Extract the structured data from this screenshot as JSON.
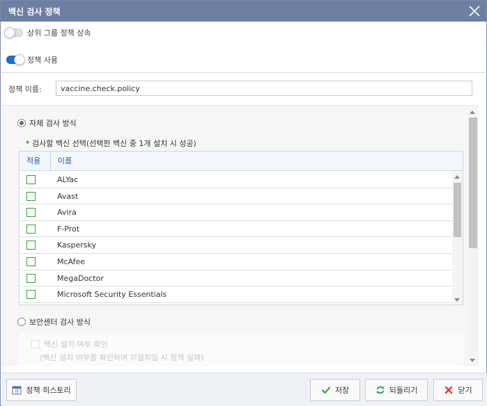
{
  "dialog": {
    "title": "백신 검사 정책",
    "close_icon": "close-icon"
  },
  "toggles": {
    "inherit_label": "상위 그룹 정책 상속",
    "inherit_on": false,
    "use_label": "정책 사용",
    "use_on": true
  },
  "policy_name": {
    "label": "정책 이름:",
    "value": "vaccine.check.policy"
  },
  "self_check": {
    "label": "자체 검사 방식",
    "selected": true,
    "hint": "* 검사할 백신 선택(선택한 백신 중 1개 설치 시 성공)"
  },
  "grid": {
    "col_apply": "적용",
    "col_name": "이름",
    "rows": [
      {
        "name": "ALYac",
        "checked": false
      },
      {
        "name": "Avast",
        "checked": false
      },
      {
        "name": "Avira",
        "checked": false
      },
      {
        "name": "F-Prot",
        "checked": false
      },
      {
        "name": "Kaspersky",
        "checked": false
      },
      {
        "name": "McAfee",
        "checked": false
      },
      {
        "name": "MegaDoctor",
        "checked": false
      },
      {
        "name": "Microsoft Security Essentials",
        "checked": false
      }
    ]
  },
  "security_center": {
    "label": "보안센터 검사 방식",
    "selected": false,
    "check_label": "백신 설치 여부 확인",
    "check_sub": "(백신 설치 여부를 확인하여 미설치일 시 정책 실패)"
  },
  "footer": {
    "history_label": "정책 히스토리",
    "save_label": "저장",
    "revert_label": "되돌리기",
    "close_label": "닫기"
  },
  "colors": {
    "titlebar": "#6d7fa3",
    "toggle_on": "#1e6fd9",
    "checkbox_border": "#3a9a3a",
    "save_icon": "#3aa63a",
    "revert_icon": "#2a9a8a",
    "close_icon": "#e03a2a"
  }
}
